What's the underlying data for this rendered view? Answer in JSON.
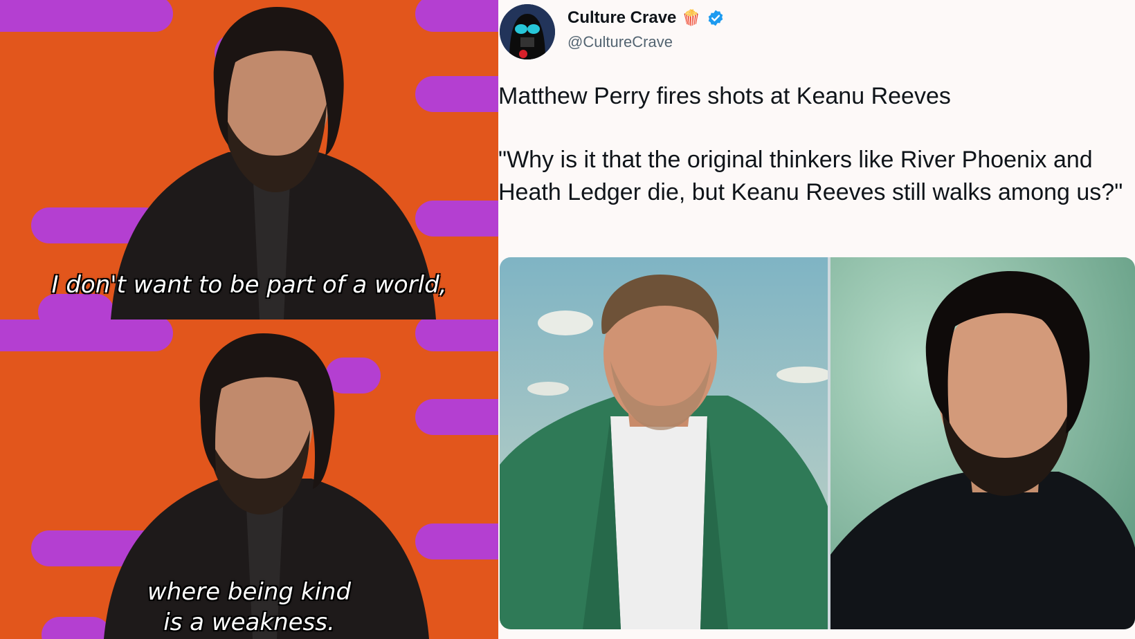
{
  "meme": {
    "top_caption": "I don't want to be part of a world,",
    "bottom_caption_line1": "where being kind",
    "bottom_caption_line2": "is a weakness.",
    "background_color": "#e2561c",
    "stripe_color": "#b43fd1"
  },
  "tweet": {
    "display_name": "Culture Crave",
    "badge_emoji": "🍿",
    "verified_icon": "verified-badge-icon",
    "handle": "@CultureCrave",
    "text_line1": "Matthew Perry fires shots at Keanu Reeves",
    "text_quote": "\"Why is it that the original thinkers like River Phoenix and Heath Ledger die, but Keanu Reeves still walks among us?\"",
    "verified_color": "#1d9bf0"
  }
}
